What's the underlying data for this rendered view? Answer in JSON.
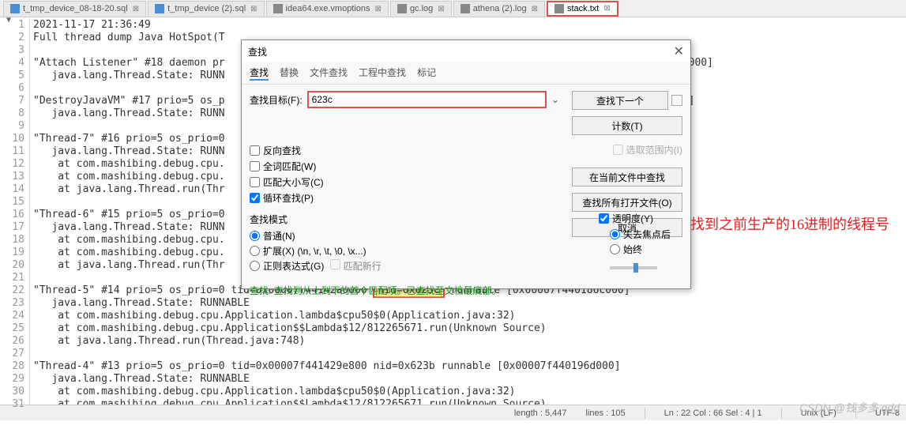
{
  "tabs": [
    {
      "label": "t_tmp_device_08-18-20.sql",
      "icon": "sql"
    },
    {
      "label": "t_tmp_device (2).sql",
      "icon": "sql"
    },
    {
      "label": "idea64.exe.vmoptions",
      "icon": "txt"
    },
    {
      "label": "gc.log",
      "icon": "txt"
    },
    {
      "label": "athena (2).log",
      "icon": "txt"
    },
    {
      "label": "stack.txt",
      "icon": "txt",
      "active": true
    }
  ],
  "lines": [
    "2021-11-17 21:36:49",
    "Full thread dump Java HotSpot(T",
    "",
    "\"Attach Listener\" #18 daemon pr                                                                 0000000000000]",
    "   java.lang.Thread.State: RUNN",
    "",
    "\"DestroyJavaVM\" #17 prio=5 os_p                                                                 0000000000]",
    "   java.lang.Thread.State: RUNN",
    "",
    "\"Thread-7\" #16 prio=5 os_prio=0",
    "   java.lang.Thread.State: RUNN",
    "    at com.mashibing.debug.cpu.",
    "    at com.mashibing.debug.cpu.",
    "    at java.lang.Thread.run(Thr",
    "",
    "\"Thread-6\" #15 prio=5 os_prio=0",
    "   java.lang.Thread.State: RUNN",
    "    at com.mashibing.debug.cpu.",
    "    at com.mashibing.debug.cpu.",
    "    at java.lang.Thread.run(Thr",
    "",
    "\"Thread-5\" #14 prio=5 os_prio=0 tid=0x00007f44142a0000 nid=0x623c runnable [0x00007f440186c000]",
    "   java.lang.Thread.State: RUNNABLE",
    "    at com.mashibing.debug.cpu.Application.lambda$cpu50$0(Application.java:32)",
    "    at com.mashibing.debug.cpu.Application$$Lambda$12/812265671.run(Unknown Source)",
    "    at java.lang.Thread.run(Thread.java:748)",
    "",
    "\"Thread-4\" #13 prio=5 os_prio=0 tid=0x00007f441429e800 nid=0x623b runnable [0x00007f440196d000]",
    "   java.lang.Thread.State: RUNNABLE",
    "    at com.mashibing.debug.cpu.Application.lambda$cpu50$0(Application.java:32)",
    "    at com.mashibing.debug.cpu.Application$$Lambda$12/812265671.run(Unknown Source)"
  ],
  "highlight": {
    "line": 22,
    "text": "nid=0x623c",
    "prefix": "\"Thread-5\" #14 prio=5 os_prio=0 tid=0x00007f44142a0000 ",
    "suffix": " runnable [0x00007f440186c000]"
  },
  "dialog": {
    "title": "查找",
    "tabs": [
      "查找",
      "替换",
      "文件查找",
      "工程中查找",
      "标记"
    ],
    "search_label": "查找目标(F):",
    "search_value": "623c",
    "range_label": "选取范围内(I)",
    "buttons": {
      "next": "查找下一个",
      "count": "计数(T)",
      "infile": "在当前文件中查找",
      "allfiles": "查找所有打开文件(O)",
      "cancel": "取消"
    },
    "opts": {
      "rev": "反向查找",
      "whole": "全词匹配(W)",
      "case": "匹配大小写(C)",
      "wrap": "循环查找(P)"
    },
    "mode_title": "查找模式",
    "modes": {
      "normal": "普通(N)",
      "ext": "扩展(X) (\\n, \\r, \\t, \\0, \\x...)",
      "regex": "正则表达式(G)",
      "regex_sub": "匹配新行"
    },
    "trans": {
      "label": "透明度(Y)",
      "onblur": "失去焦点后",
      "always": "始终"
    },
    "msg": "查找: 查找到从上到下的首个匹配项。已查找至文档最底部。"
  },
  "annotation": "找到之前生产的16进制的线程号",
  "statusbar": {
    "length": "length : 5,447",
    "lines": "lines : 105",
    "pos": "Ln : 22   Col : 66   Sel : 4 | 1",
    "eol": "Unix (LF)",
    "enc": "UTF-8"
  },
  "watermark": "CSDN @钱多多 qdd"
}
